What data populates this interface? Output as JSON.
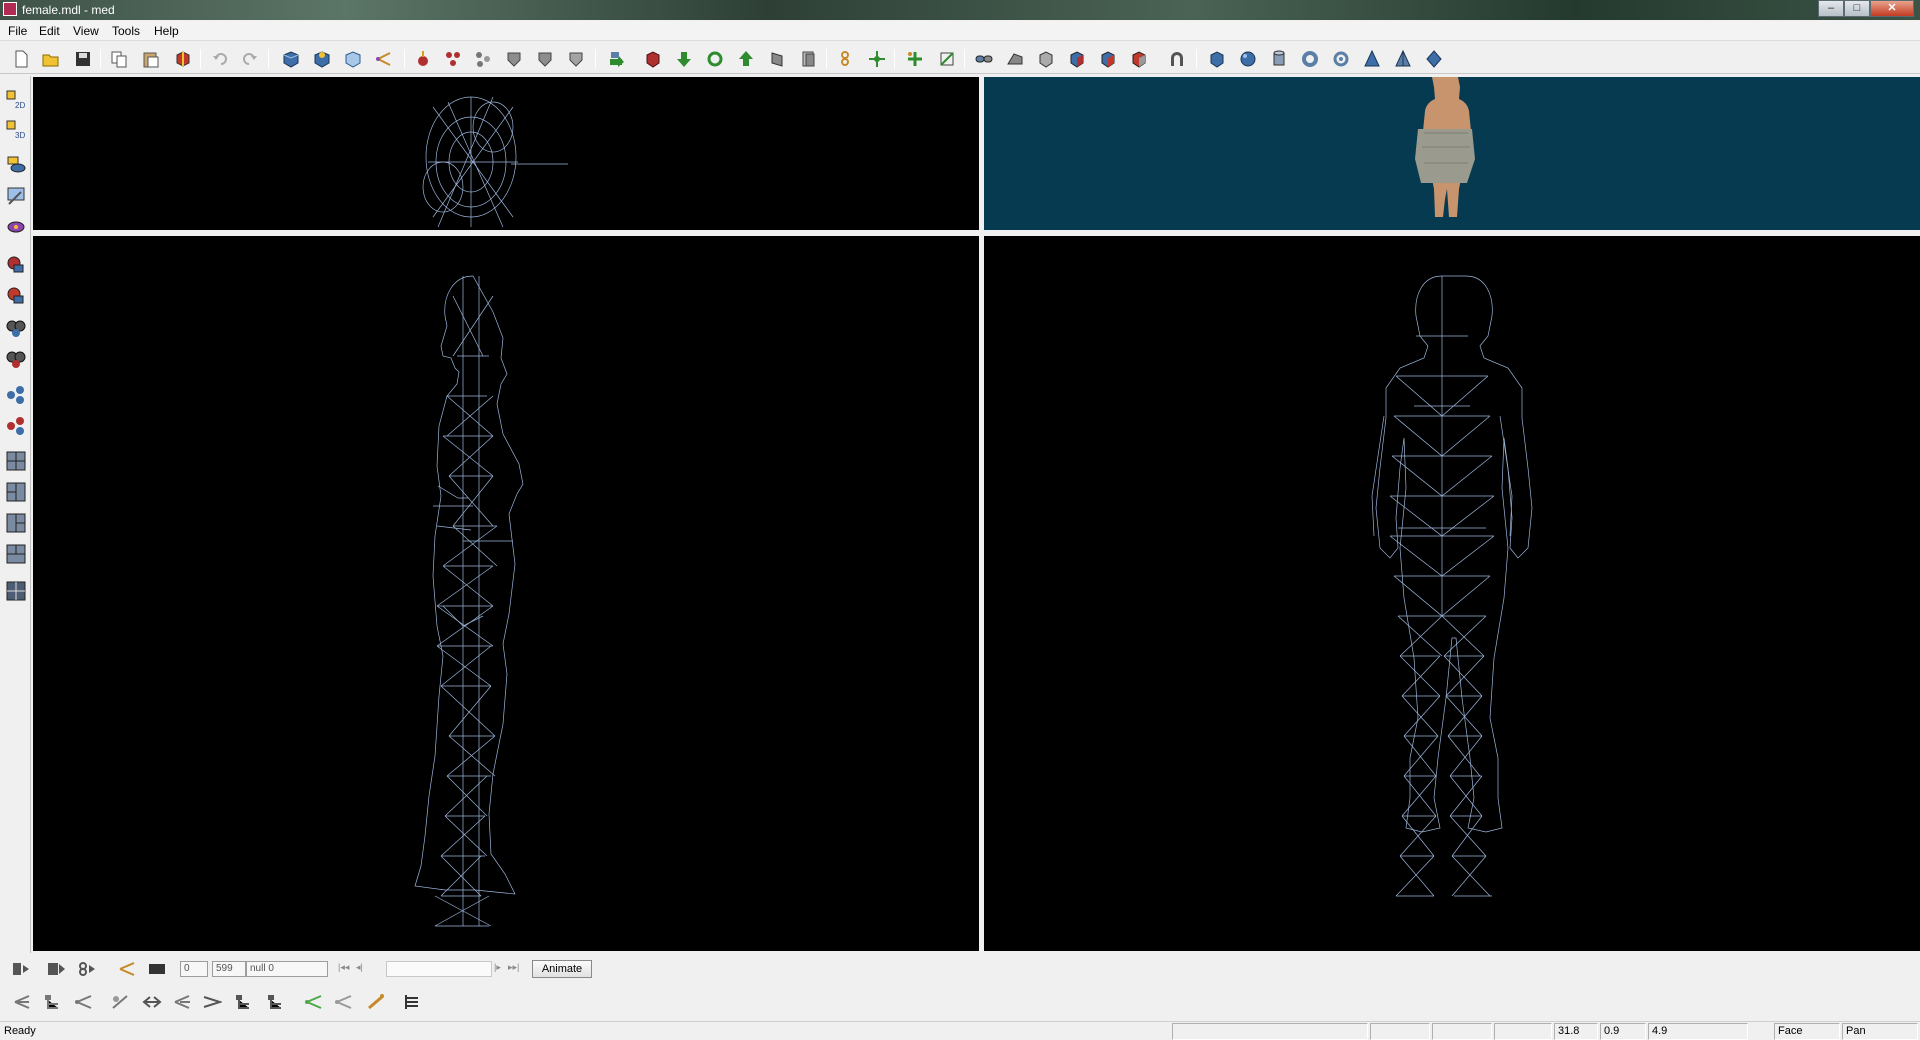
{
  "window": {
    "title": "female.mdl - med",
    "minimize": "–",
    "maximize": "□",
    "close": "✕"
  },
  "menu": {
    "items": [
      "File",
      "Edit",
      "View",
      "Tools",
      "Help"
    ]
  },
  "toolbar": {
    "icons": [
      "new-file-icon",
      "open-folder-icon",
      "save-icon",
      "copy-icon",
      "paste-icon",
      "import-icon",
      "undo-icon",
      "redo-icon",
      "blue-cube-icon",
      "cube-gear-icon",
      "light-cube-icon",
      "share-nodes-icon",
      "red-pin-icon",
      "red-hierarchy-icon",
      "gray-hierarchy-icon",
      "gray-shield-icon",
      "gray-shield-2-icon",
      "gray-shield-3-icon",
      "forward-arrow-icon",
      "red-cube-icon",
      "green-down-arrow-icon",
      "green-rotate-icon",
      "green-up-arrow-icon",
      "gray-slab-icon",
      "gray-pages-icon",
      "chain-icon",
      "green-move-icon",
      "plus-node-icon",
      "resize-box-icon",
      "link-icon",
      "gray-shape-icon",
      "gray-box-icon",
      "red-box-icon",
      "red-blue-box-icon",
      "red-gray-box-icon",
      "magnet-icon",
      "cube-primitive-icon",
      "sphere-primitive-icon",
      "cylinder-primitive-icon",
      "torus-primitive-icon",
      "torus-knot-primitive-icon",
      "cone-primitive-icon",
      "pyramid-primitive-icon",
      "diamond-primitive-icon"
    ]
  },
  "lefttoolbar": {
    "icons": [
      "view-2d-icon",
      "view-3d-icon",
      "camera-view-icon",
      "texture-view-icon",
      "material-view-icon",
      "red-light-icon",
      "red-light-2-icon",
      "eye-icon",
      "eye-red-icon",
      "blue-nodes-icon",
      "red-nodes-icon",
      "layout-quad-icon",
      "layout-split-icon",
      "layout-left-icon",
      "layout-bottom-icon",
      "layout-grid-icon"
    ]
  },
  "viewports": {
    "top": "wireframe",
    "preview": "textured",
    "side": "wireframe",
    "front": "wireframe"
  },
  "colors": {
    "wire": "#9db6dc",
    "preview_bg": "#053a50",
    "viewport_bg": "#000000"
  },
  "animbar": {
    "frame_start": "0",
    "frame_end": "599",
    "anim_name": "null 0",
    "animate_label": "Animate",
    "rewind": "|◂◂",
    "step_back": "◂|",
    "step_fwd": "|▸",
    "fast_fwd": "▸▸|"
  },
  "modbar": {
    "icons": [
      "nodes-icon",
      "nodes-tree-icon",
      "nodes-link-icon",
      "nodes-edit-icon",
      "arrows-icon",
      "nodes-swap-icon",
      "nodes-move-icon",
      "tree-plus-icon",
      "tree-minus-icon",
      "green-nodes-icon",
      "gray-nodes-icon",
      "bone-icon",
      "skeleton-icon"
    ]
  },
  "status": {
    "ready": "Ready",
    "x": "31.8",
    "y": "0.9",
    "z": "4.9",
    "mode": "Face",
    "tool": "Pan"
  }
}
